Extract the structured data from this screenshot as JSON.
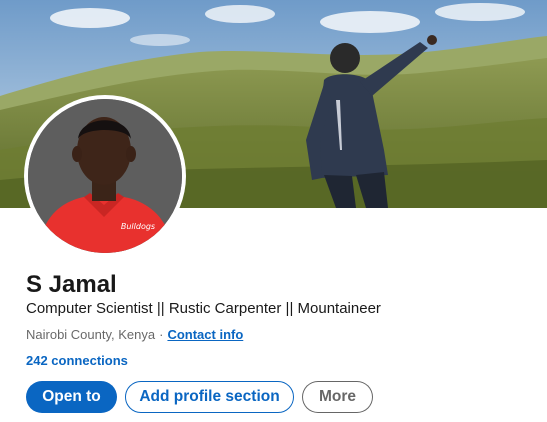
{
  "profile": {
    "name": "S Jamal",
    "headline": "Computer Scientist || Rustic Carpenter || Mountaineer",
    "location": "Nairobi County, Kenya",
    "separator": "·",
    "contact_info_label": "Contact info",
    "connections_label": "242 connections",
    "avatar_shirt_text": "Bulldogs"
  },
  "actions": {
    "open_to_label": "Open to",
    "add_section_label": "Add profile section",
    "more_label": "More"
  },
  "colors": {
    "accent": "#0a66c2",
    "cover_sky": "#9fc0de",
    "cover_hills": "#7d8a3e",
    "avatar_shirt": "#e8312e"
  }
}
